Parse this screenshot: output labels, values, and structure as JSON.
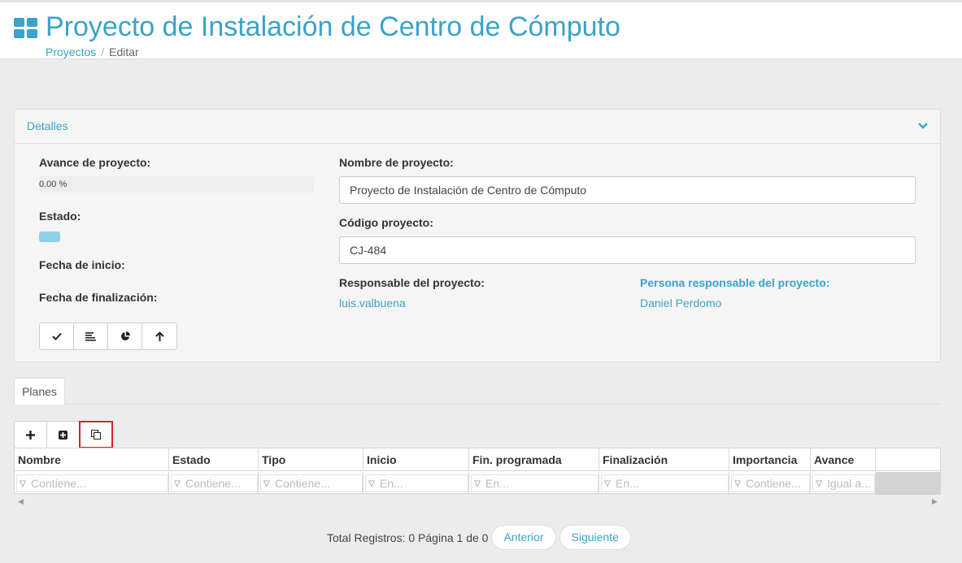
{
  "header": {
    "title": "Proyecto de Instalación de Centro de Cómputo",
    "breadcrumb": {
      "parent": "Proyectos",
      "separator": "/",
      "current": "Editar"
    }
  },
  "details": {
    "panel_title": "Detalles",
    "progress_label": "Avance de proyecto:",
    "progress_text": "0.00 %",
    "progress_value": 0,
    "state_label": "Estado:",
    "start_label": "Fecha de inicio:",
    "end_label": "Fecha de finalización:",
    "name_label": "Nombre de proyecto:",
    "name_value": "Proyecto de Instalación de Centro de Cómputo",
    "code_label": "Código proyecto:",
    "code_value": "CJ-484",
    "owner_label": "Responsable del proyecto:",
    "owner_value": "luis.valbuena",
    "person_label": "Persona responsable del proyecto:",
    "person_value": "Daniel Perdomo",
    "action_icons": [
      "check-icon",
      "align-left-icon",
      "pie-chart-icon",
      "arrow-up-icon"
    ]
  },
  "tabs": {
    "planes": "Planes"
  },
  "toolbar": {
    "icons": [
      "plus-icon",
      "plus-square-icon",
      "copy-icon"
    ]
  },
  "grid": {
    "columns": [
      "Nombre",
      "Estado",
      "Tipo",
      "Inicio",
      "Fin. programada",
      "Finalización",
      "Importancia",
      "Avance"
    ],
    "filters": [
      "Contiene...",
      "Contiene...",
      "Contiene...",
      "En...",
      "En...",
      "En...",
      "Contiene...",
      "Igual a..."
    ]
  },
  "pager": {
    "summary": "Total Registros: 0 Página 1 de 0",
    "prev": "Anterior",
    "next": "Siguiente"
  },
  "colors": {
    "accent": "#3aa3c9",
    "highlight": "#d9232d"
  }
}
